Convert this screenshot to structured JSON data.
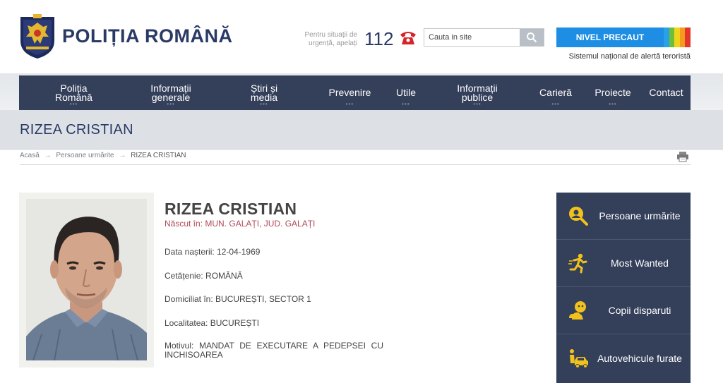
{
  "header": {
    "brand": "POLIȚIA ROMÂNĂ",
    "emergency_text": "Pentru situații de urgență, apelați",
    "emergency_number": "112",
    "search_placeholder": "Cauta in site",
    "alert_level": "NIVEL PRECAUT",
    "alert_colors": [
      "#2aa0e6",
      "#6cbf3a",
      "#f2d31c",
      "#f49a1f",
      "#e3352b"
    ],
    "alert_subtitle": "Sistemul național de alertă teroristă"
  },
  "nav": {
    "items": [
      {
        "label": "Poliția Română"
      },
      {
        "label": "Informații generale"
      },
      {
        "label": "Știri și media"
      },
      {
        "label": "Prevenire"
      },
      {
        "label": "Utile"
      },
      {
        "label": "Informații publice"
      },
      {
        "label": "Carieră"
      },
      {
        "label": "Proiecte"
      },
      {
        "label": "Contact"
      }
    ],
    "dots": "•••"
  },
  "page": {
    "title": "RIZEA CRISTIAN"
  },
  "breadcrumb": {
    "home": "Acasă",
    "section": "Persoane urmărite",
    "current": "RIZEA CRISTIAN",
    "separator": "→"
  },
  "person": {
    "name": "RIZEA CRISTIAN",
    "birthplace": "Născut în: MUN. GALAȚI, JUD. GALAȚI",
    "birth_date": "Data nașterii: 12-04-1969",
    "citizenship": "Cetățenie: ROMÂNĂ",
    "domicile": "Domiciliat în: BUCUREȘTI, SECTOR 1",
    "locality": "Localitatea: BUCUREȘTI",
    "motive": "Motivul: MANDAT DE EXECUTARE A PEDEPSEI CU INCHISOAREA"
  },
  "sidebar": {
    "items": [
      {
        "label": "Persoane urmărite",
        "icon": "search-person-icon"
      },
      {
        "label": "Most Wanted",
        "icon": "running-person-icon"
      },
      {
        "label": "Copii disparuti",
        "icon": "missing-child-icon"
      },
      {
        "label": "Autovehicule furate",
        "icon": "stolen-car-icon"
      }
    ]
  }
}
